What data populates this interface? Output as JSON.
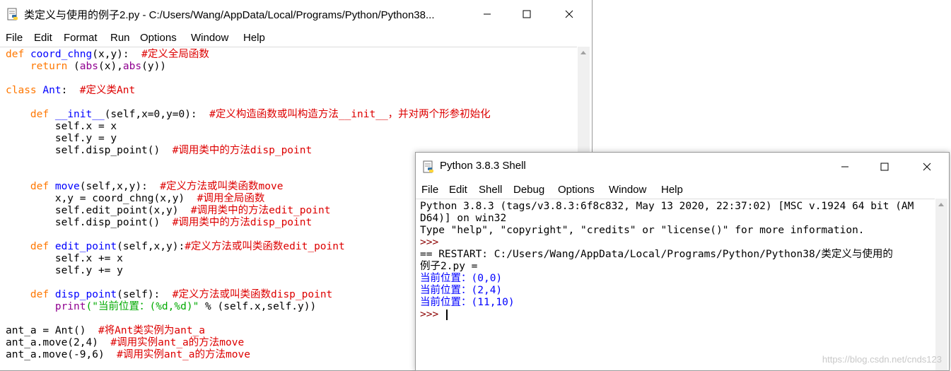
{
  "editor_window": {
    "title": "类定义与使用的例子2.py - C:/Users/Wang/AppData/Local/Programs/Python/Python38...",
    "menu": [
      "File",
      "Edit",
      "Format",
      "Run",
      "Options",
      "Window",
      "Help"
    ]
  },
  "code_lines": [
    [
      {
        "t": "def",
        "c": "kw"
      },
      {
        "t": " "
      },
      {
        "t": "coord_chng",
        "c": "fn"
      },
      {
        "t": "(x,y):  "
      },
      {
        "t": "#定义全局函数",
        "c": "cm"
      }
    ],
    [
      {
        "t": "    "
      },
      {
        "t": "return",
        "c": "kw"
      },
      {
        "t": " ("
      },
      {
        "t": "abs",
        "c": "bi"
      },
      {
        "t": "(x),"
      },
      {
        "t": "abs",
        "c": "bi"
      },
      {
        "t": "(y))"
      }
    ],
    [],
    [
      {
        "t": "class",
        "c": "kw"
      },
      {
        "t": " "
      },
      {
        "t": "Ant",
        "c": "fn"
      },
      {
        "t": ":  "
      },
      {
        "t": "#定义类Ant",
        "c": "cm"
      }
    ],
    [],
    [
      {
        "t": "    "
      },
      {
        "t": "def",
        "c": "kw"
      },
      {
        "t": " "
      },
      {
        "t": "__init__",
        "c": "fn"
      },
      {
        "t": "(self,x=0,y=0):  "
      },
      {
        "t": "#定义构造函数或叫构造方法__init__，并对两个形参初始化",
        "c": "cm"
      }
    ],
    [
      {
        "t": "        self.x = x"
      }
    ],
    [
      {
        "t": "        self.y = y"
      }
    ],
    [
      {
        "t": "        self.disp_point()  "
      },
      {
        "t": "#调用类中的方法disp_point",
        "c": "cm"
      }
    ],
    [],
    [],
    [
      {
        "t": "    "
      },
      {
        "t": "def",
        "c": "kw"
      },
      {
        "t": " "
      },
      {
        "t": "move",
        "c": "fn"
      },
      {
        "t": "(self,x,y):  "
      },
      {
        "t": "#定义方法或叫类函数move",
        "c": "cm"
      }
    ],
    [
      {
        "t": "        x,y = coord_chng(x,y)  "
      },
      {
        "t": "#调用全局函数",
        "c": "cm"
      }
    ],
    [
      {
        "t": "        self.edit_point(x,y)  "
      },
      {
        "t": "#调用类中的方法edit_point",
        "c": "cm"
      }
    ],
    [
      {
        "t": "        self.disp_point()  "
      },
      {
        "t": "#调用类中的方法disp_point",
        "c": "cm"
      }
    ],
    [],
    [
      {
        "t": "    "
      },
      {
        "t": "def",
        "c": "kw"
      },
      {
        "t": " "
      },
      {
        "t": "edit_point",
        "c": "fn"
      },
      {
        "t": "(self,x,y):"
      },
      {
        "t": "#定义方法或叫类函数edit_point",
        "c": "cm"
      }
    ],
    [
      {
        "t": "        self.x += x"
      }
    ],
    [
      {
        "t": "        self.y += y"
      }
    ],
    [],
    [
      {
        "t": "    "
      },
      {
        "t": "def",
        "c": "kw"
      },
      {
        "t": " "
      },
      {
        "t": "disp_point",
        "c": "fn"
      },
      {
        "t": "(self):  "
      },
      {
        "t": "#定义方法或叫类函数disp_point",
        "c": "cm"
      }
    ],
    [
      {
        "t": "        "
      },
      {
        "t": "print",
        "c": "bi"
      },
      {
        "t": "(\"当前位置：(%d,%d)\"",
        "c": "st"
      },
      {
        "t": " % (self.x,self.y))"
      }
    ],
    [],
    [
      {
        "t": "ant_a = Ant()  "
      },
      {
        "t": "#将Ant类实例为ant_a",
        "c": "cm"
      }
    ],
    [
      {
        "t": "ant_a.move(2,4)  "
      },
      {
        "t": "#调用实例ant_a的方法move",
        "c": "cm"
      }
    ],
    [
      {
        "t": "ant_a.move(-9,6)  "
      },
      {
        "t": "#调用实例ant_a的方法move",
        "c": "cm"
      }
    ]
  ],
  "shell_window": {
    "title": "Python 3.8.3 Shell",
    "menu": [
      "File",
      "Edit",
      "Shell",
      "Debug",
      "Options",
      "Window",
      "Help"
    ]
  },
  "shell_lines": [
    [
      {
        "t": "Python 3.8.3 (tags/v3.8.3:6f8c832, May 13 2020, 22:37:02) [MSC v.1924 64 bit (AM"
      }
    ],
    [
      {
        "t": "D64)] on win32"
      }
    ],
    [
      {
        "t": "Type \"help\", \"copyright\", \"credits\" or \"license()\" for more information."
      }
    ],
    [
      {
        "t": ">>> ",
        "c": "pr"
      }
    ],
    [
      {
        "t": "== RESTART: C:/Users/Wang/AppData/Local/Programs/Python/Python38/类定义与使用的"
      }
    ],
    [
      {
        "t": "例子2.py ="
      }
    ],
    [
      {
        "t": "当前位置：(0,0)",
        "c": "out"
      }
    ],
    [
      {
        "t": "当前位置：(2,4)",
        "c": "out"
      }
    ],
    [
      {
        "t": "当前位置：(11,10)",
        "c": "out"
      }
    ],
    [
      {
        "t": ">>> ",
        "c": "pr"
      },
      {
        "cursor": true
      }
    ]
  ],
  "watermark": "https://blog.csdn.net/cnds123",
  "icons": {
    "app": "python-idle-icon",
    "minimize": "minimize-icon",
    "maximize": "maximize-icon",
    "close": "close-icon"
  }
}
